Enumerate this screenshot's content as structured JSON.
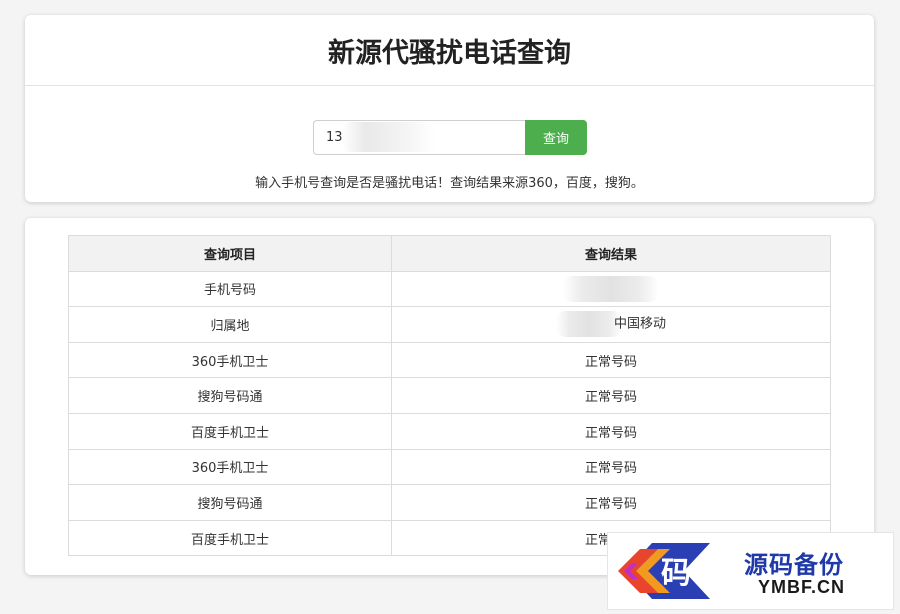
{
  "page": {
    "title": "新源代骚扰电话查询"
  },
  "search": {
    "input_value": "13",
    "button_label": "查询",
    "hint": "输入手机号查询是否是骚扰电话！查询结果来源360，百度，搜狗。"
  },
  "table": {
    "headers": [
      "查询项目",
      "查询结果"
    ],
    "rows": [
      {
        "item": "手机号码",
        "result": ""
      },
      {
        "item": "归属地",
        "result": "中国移动"
      },
      {
        "item": "360手机卫士",
        "result": "正常号码"
      },
      {
        "item": "搜狗号码通",
        "result": "正常号码"
      },
      {
        "item": "百度手机卫士",
        "result": "正常号码"
      },
      {
        "item": "360手机卫士",
        "result": "正常号码"
      },
      {
        "item": "搜狗号码通",
        "result": "正常号码"
      },
      {
        "item": "百度手机卫士",
        "result": "正常号码"
      }
    ]
  },
  "watermark": {
    "logo_char": "码",
    "name": "源码备份",
    "domain": "YMBF.CN"
  },
  "colors": {
    "accent": "#4cae4c",
    "watermark_text": "#1f3aa8"
  }
}
